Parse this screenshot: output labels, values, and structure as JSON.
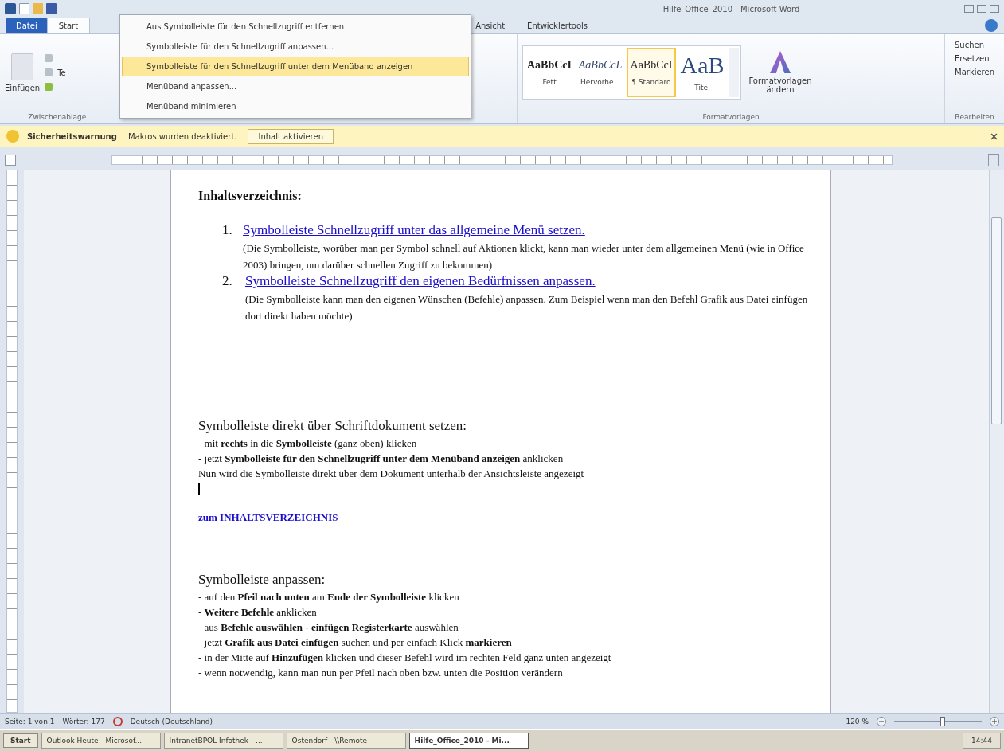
{
  "window": {
    "title": "Hilfe_Office_2010 - Microsoft Word"
  },
  "file_button": "Datei",
  "tabs": [
    {
      "label": "Start",
      "selected": true
    },
    {
      "label": "Ansicht",
      "selected": false
    },
    {
      "label": "Entwicklertools",
      "selected": false
    }
  ],
  "qat_menu": [
    {
      "label": "Aus Symbolleiste für den Schnellzugriff entfernen",
      "selected": false
    },
    {
      "label": "Symbolleiste für den Schnellzugriff anpassen...",
      "selected": false
    },
    {
      "label": "Symbolleiste für den Schnellzugriff unter dem Menüband anzeigen",
      "selected": true
    },
    {
      "label": "Menüband anpassen...",
      "selected": false
    },
    {
      "label": "Menüband minimieren",
      "selected": false
    }
  ],
  "ribbon": {
    "paste_label": "Einfügen",
    "clipboard_group": "Zwischenablage",
    "font_fragment": "Te",
    "styles": [
      {
        "sample": "AaBbCcI",
        "label": "Fett",
        "kind": "bold",
        "selected": false
      },
      {
        "sample": "AaBbCcL",
        "label": "Hervorhe...",
        "kind": "italic",
        "selected": false
      },
      {
        "sample": "AaBbCcI",
        "label": "¶ Standard",
        "kind": "normal",
        "selected": true
      },
      {
        "sample": "AaB",
        "label": "Titel",
        "kind": "title",
        "selected": false
      }
    ],
    "change_styles": "Formatvorlagen ändern",
    "styles_group": "Formatvorlagen",
    "editing": [
      "Suchen",
      "Ersetzen",
      "Markieren"
    ],
    "editing_group": "Bearbeiten"
  },
  "warning": {
    "title": "Sicherheitswarnung",
    "message": "Makros wurden deaktiviert.",
    "button": "Inhalt aktivieren"
  },
  "document": {
    "toc_heading": "Inhaltsverzeichnis:",
    "toc": [
      {
        "number": "1.",
        "link": "Symbolleiste Schnellzugriff unter das allgemeine Menü setzen.",
        "description": "(Die Symbolleiste, worüber man per Symbol schnell auf Aktionen klickt, kann man wieder unter dem allgemeinen Menü (wie in Office 2003) bringen, um darüber schnellen Zugriff zu bekommen)"
      },
      {
        "number": "2.",
        "link": "Symbolleiste Schnellzugriff den eigenen Bedürfnissen anpassen.",
        "description": "(Die Symbolleiste kann man den eigenen Wünschen (Befehle) anpassen. Zum Beispiel wenn man den Befehl Grafik aus Datei einfügen dort direkt haben möchte)"
      }
    ],
    "sections": [
      {
        "heading": "Symbolleiste direkt über Schriftdokument setzen:",
        "lines": [
          "- mit **rechts** in die **Symbolleiste** (ganz oben) klicken",
          "- jetzt **Symbolleiste für den Schnellzugriff unter dem Menüband anzeigen** anklicken",
          "Nun wird die Symbolleiste direkt über dem Dokument unterhalb der Ansichtsleiste angezeigt"
        ],
        "caret": true,
        "back_link": "zum INHALTSVERZEICHNIS"
      },
      {
        "heading": "Symbolleiste anpassen:",
        "lines": [
          "- auf den **Pfeil nach unten** am **Ende der Symbolleiste** klicken",
          "- **Weitere Befehle** anklicken",
          "- aus **Befehle auswählen - einfügen Registerkarte** auswählen",
          "- jetzt **Grafik aus Datei einfügen** suchen und per einfach Klick **markieren**",
          "- in der Mitte auf **Hinzufügen** klicken und dieser Befehl wird im rechten Feld ganz unten angezeigt",
          "- wenn notwendig, kann man nun per Pfeil nach oben bzw. unten die Position verändern"
        ]
      }
    ]
  },
  "status_bar": {
    "page": "Seite: 1 von 1",
    "words": "Wörter: 177",
    "language": "Deutsch (Deutschland)",
    "zoom": "120 %",
    "zoom_slider": {
      "level": 0.55
    }
  },
  "taskbar": {
    "start": "Start",
    "tasks": [
      {
        "label": "Outlook Heute - Microsof...",
        "selected": false
      },
      {
        "label": "IntranetBPOL Infothek - ...",
        "selected": false
      },
      {
        "label": "Ostendorf - \\\\Remote",
        "selected": false
      },
      {
        "label": "Hilfe_Office_2010 - Mi...",
        "selected": true
      }
    ],
    "time": "14:44"
  }
}
